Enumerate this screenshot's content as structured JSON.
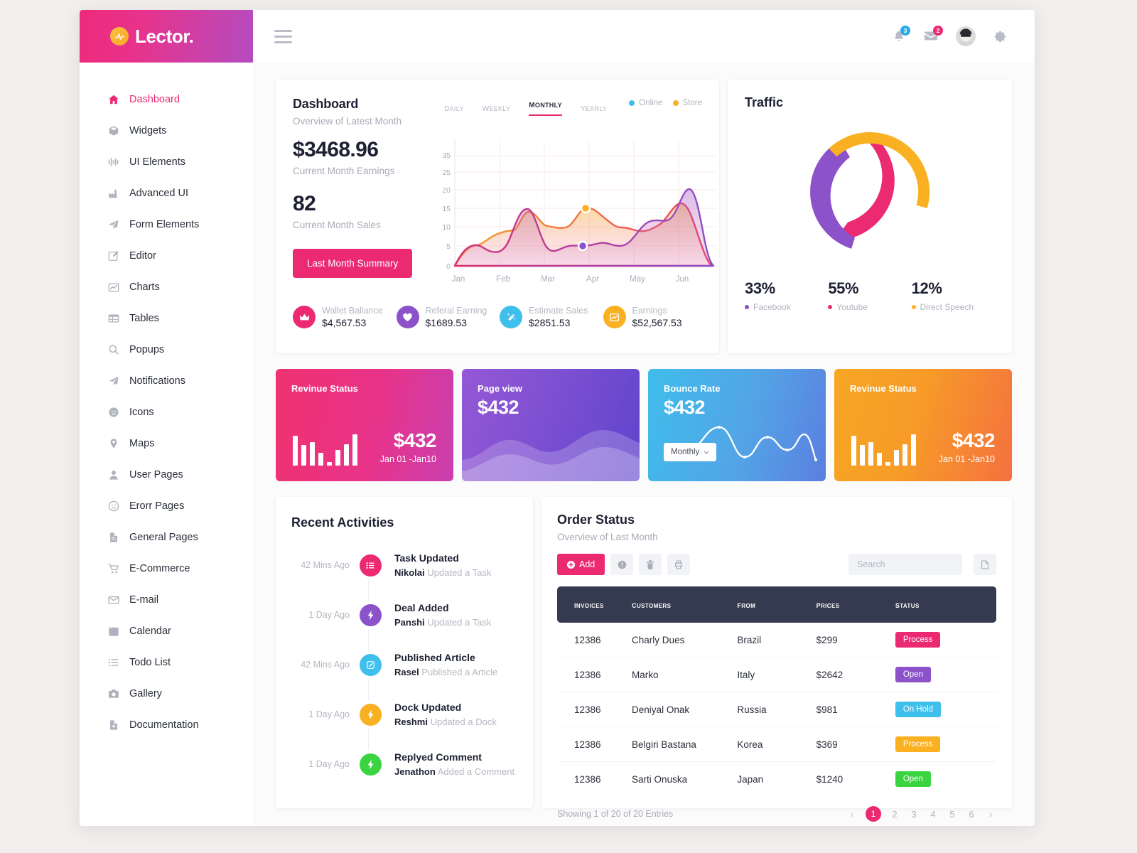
{
  "brand": {
    "name": "Lector.",
    "mark_icon": "pulse-icon"
  },
  "topbar": {
    "menu_icon": "hamburger-icon",
    "notifications": {
      "icon": "bell-icon",
      "count": "3"
    },
    "messages": {
      "icon": "envelope-icon",
      "count": "2"
    },
    "avatar": "user-avatar",
    "settings_icon": "gear-icon"
  },
  "sidebar": {
    "items": [
      {
        "label": "Dashboard",
        "icon": "home-icon",
        "active": true
      },
      {
        "label": "Widgets",
        "icon": "box-icon",
        "active": false
      },
      {
        "label": "UI Elements",
        "icon": "sliders-icon",
        "active": false
      },
      {
        "label": "Advanced UI",
        "icon": "factory-icon",
        "active": false
      },
      {
        "label": "Form Elements",
        "icon": "paper-plane-icon",
        "active": false
      },
      {
        "label": "Editor",
        "icon": "pencil-square-icon",
        "active": false
      },
      {
        "label": "Charts",
        "icon": "chart-line-icon",
        "active": false
      },
      {
        "label": "Tables",
        "icon": "table-icon",
        "active": false
      },
      {
        "label": "Popups",
        "icon": "search-icon",
        "active": false
      },
      {
        "label": "Notifications",
        "icon": "send-icon",
        "active": false
      },
      {
        "label": "Icons",
        "icon": "frown-face-icon",
        "active": false
      },
      {
        "label": "Maps",
        "icon": "map-pin-icon",
        "active": false
      },
      {
        "label": "User Pages",
        "icon": "person-icon",
        "active": false
      },
      {
        "label": "Erorr Pages",
        "icon": "smiley-icon",
        "active": false
      },
      {
        "label": "General Pages",
        "icon": "document-icon",
        "active": false
      },
      {
        "label": "E-Commerce",
        "icon": "cart-icon",
        "active": false
      },
      {
        "label": "E-mail",
        "icon": "mail-icon",
        "active": false
      },
      {
        "label": "Calendar",
        "icon": "calendar-icon",
        "active": false
      },
      {
        "label": "Todo List",
        "icon": "list-icon",
        "active": false
      },
      {
        "label": "Gallery",
        "icon": "camera-icon",
        "active": false
      },
      {
        "label": "Documentation",
        "icon": "file-download-icon",
        "active": false
      }
    ]
  },
  "dashboard_card": {
    "title": "Dashboard",
    "subtitle": "Overview of Latest Month",
    "tabs": [
      {
        "label": "Daily",
        "active": false
      },
      {
        "label": "Weekly",
        "active": false
      },
      {
        "label": "Monthly",
        "active": true
      },
      {
        "label": "Yearly",
        "active": false
      }
    ],
    "legend": [
      {
        "label": "Online",
        "color": "#3fc0ec"
      },
      {
        "label": "Store",
        "color": "#f9b122"
      }
    ],
    "kpi1_value": "$3468.96",
    "kpi1_label": "Current Month Earnings",
    "kpi2_value": "82",
    "kpi2_label": "Current Month Sales",
    "summary_button": "Last Month Summary",
    "stats": [
      {
        "label": "Wallet Ballance",
        "value": "$4,567.53",
        "icon": "crown-icon",
        "color": "#ec2a72"
      },
      {
        "label": "Referal Earning",
        "value": "$1689.53",
        "icon": "heart-icon",
        "color": "#8b52c9"
      },
      {
        "label": "Estimate Sales",
        "value": "$2851.53",
        "icon": "magic-wand-icon",
        "color": "#3fc0ec"
      },
      {
        "label": "Earnings",
        "value": "$52,567.53",
        "icon": "chart-icon",
        "color": "#f9b122"
      }
    ]
  },
  "traffic_card": {
    "title": "Traffic",
    "stats": [
      {
        "value": "33%",
        "label": "Facebook",
        "color": "#8b52c9"
      },
      {
        "value": "55%",
        "label": "Youtube",
        "color": "#ec2a72"
      },
      {
        "value": "12%",
        "label": "Direct Speech",
        "color": "#f9b122"
      }
    ]
  },
  "gradient_cards": [
    {
      "title": "Revinue Status",
      "amount": "$432",
      "range": "Jan 01 -Jan10",
      "style": "pink",
      "visual": "bars"
    },
    {
      "title": "Page view",
      "amount": "$432",
      "range": "",
      "style": "purple",
      "visual": "wave"
    },
    {
      "title": "Bounce Rate",
      "amount": "$432",
      "range": "",
      "style": "blue",
      "visual": "sine",
      "select": "Monthly"
    },
    {
      "title": "Revinue Status",
      "amount": "$432",
      "range": "Jan 01 -Jan10",
      "style": "orange",
      "visual": "bars"
    }
  ],
  "recent_activities": {
    "title": "Recent Activities",
    "items": [
      {
        "time": "42 Mins Ago",
        "heading": "Task Updated",
        "who": "Nikolai",
        "action": "Updated a Task",
        "icon": "list-icon",
        "color": "#ec2a72"
      },
      {
        "time": "1 Day Ago",
        "heading": "Deal Added",
        "who": "Panshi",
        "action": "Updated a Task",
        "icon": "bolt-icon",
        "color": "#8b52c9"
      },
      {
        "time": "42 Mins Ago",
        "heading": "Published Article",
        "who": "Rasel",
        "action": "Published a Article",
        "icon": "pencil-icon",
        "color": "#3fc0ec"
      },
      {
        "time": "1 Day Ago",
        "heading": "Dock Updated",
        "who": "Reshmi",
        "action": "Updated a Dock",
        "icon": "bolt-icon",
        "color": "#f9b122"
      },
      {
        "time": "1 Day Ago",
        "heading": "Replyed Comment",
        "who": "Jenathon",
        "action": "Added a Comment",
        "icon": "bolt-icon",
        "color": "#3ad441"
      }
    ]
  },
  "order_status": {
    "title": "Order Status",
    "subtitle": "Overview of Last Month",
    "add_button": "Add",
    "tools": [
      {
        "icon": "info-circle-icon"
      },
      {
        "icon": "trash-icon"
      },
      {
        "icon": "printer-icon"
      }
    ],
    "search_placeholder": "Search",
    "export_icon": "export-icon",
    "columns": [
      "Invoices",
      "Customers",
      "From",
      "Prices",
      "Status"
    ],
    "rows": [
      {
        "invoice": "12386",
        "customer": "Charly Dues",
        "from": "Brazil",
        "price": "$299",
        "status": "Process",
        "status_color": "#ec2a72"
      },
      {
        "invoice": "12386",
        "customer": "Marko",
        "from": "Italy",
        "price": "$2642",
        "status": "Open",
        "status_color": "#8b52c9"
      },
      {
        "invoice": "12386",
        "customer": "Deniyal Onak",
        "from": "Russia",
        "price": "$981",
        "status": "On Hold",
        "status_color": "#3fc0ec"
      },
      {
        "invoice": "12386",
        "customer": "Belgiri Bastana",
        "from": "Korea",
        "price": "$369",
        "status": "Process",
        "status_color": "#f9b122"
      },
      {
        "invoice": "12386",
        "customer": "Sarti Onuska",
        "from": "Japan",
        "price": "$1240",
        "status": "Open",
        "status_color": "#3ad441"
      }
    ],
    "footer_text": "Showing 1 of 20 of 20 Entries",
    "pages": [
      "1",
      "2",
      "3",
      "4",
      "5",
      "6"
    ],
    "current_page": "1",
    "prev_icon": "chevron-left-icon",
    "next_icon": "chevron-right-icon"
  },
  "chart_data": [
    {
      "type": "area",
      "title": "Dashboard Monthly Overview",
      "xlabel": "",
      "ylabel": "",
      "x": [
        "Jan",
        "Feb",
        "Mar",
        "Apr",
        "May",
        "Jun"
      ],
      "ticks": [
        0,
        5,
        10,
        15,
        20,
        25,
        35
      ],
      "ylim": [
        0,
        38
      ],
      "grid": true,
      "legend_position": "top-right",
      "series": [
        {
          "name": "Store",
          "color": "#f9b122",
          "values": [
            0,
            5.2,
            7.6,
            10.5,
            6.0,
            12.3,
            10.8,
            8.0,
            13.6,
            14.2,
            0
          ],
          "marker": {
            "x": "Apr",
            "y": 12.3
          }
        },
        {
          "name": "Online",
          "color": "#a855c9",
          "values": [
            0,
            5.3,
            4.0,
            11.2,
            5.2,
            5.6,
            6.6,
            5.8,
            10.5,
            18.5,
            0
          ],
          "marker": {
            "x": "Apr",
            "y": 6.6
          }
        }
      ]
    },
    {
      "type": "pie",
      "title": "Traffic",
      "labels": [
        "Facebook",
        "Youtube",
        "Direct Speech"
      ],
      "values": [
        33,
        55,
        12
      ],
      "colors": [
        "#8b52c9",
        "#ec2a72",
        "#f9b122"
      ],
      "donut": true,
      "legend_position": "bottom"
    },
    {
      "type": "bar",
      "title": "Revinue Status",
      "categories": [
        "1",
        "2",
        "3",
        "4",
        "5",
        "6",
        "7",
        "8"
      ],
      "values": [
        64,
        44,
        50,
        28,
        8,
        34,
        46,
        66
      ],
      "color": "#ffffff"
    },
    {
      "type": "area",
      "title": "Page view",
      "x": [
        "1",
        "2",
        "3",
        "4",
        "5",
        "6",
        "7"
      ],
      "values": [
        30,
        46,
        38,
        56,
        50,
        40,
        44
      ],
      "color": "#ffffff"
    },
    {
      "type": "line",
      "title": "Bounce Rate",
      "x": [
        "1",
        "2",
        "3",
        "4",
        "5",
        "6",
        "7",
        "8",
        "9"
      ],
      "values": [
        28,
        56,
        20,
        46,
        12,
        36,
        42,
        24,
        10
      ],
      "color": "#ffffff"
    },
    {
      "type": "bar",
      "title": "Revinue Status",
      "categories": [
        "1",
        "2",
        "3",
        "4",
        "5",
        "6",
        "7",
        "8"
      ],
      "values": [
        64,
        44,
        50,
        28,
        8,
        34,
        46,
        66
      ],
      "color": "#ffffff"
    }
  ]
}
